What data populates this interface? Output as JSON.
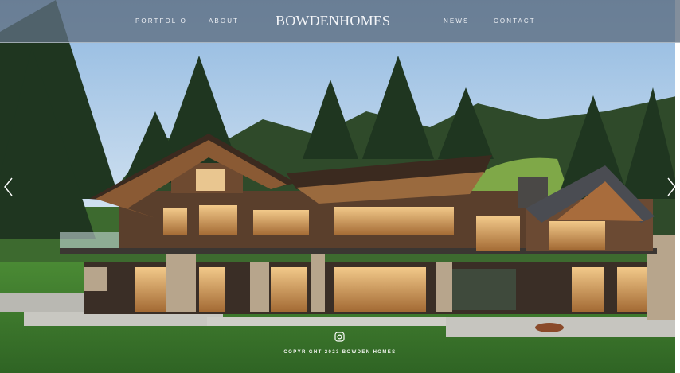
{
  "nav": {
    "left_links": [
      "PORTFOLIO",
      "ABOUT"
    ],
    "right_links": [
      "NEWS",
      "CONTACT"
    ],
    "logo_text": "BOWDENHOMES"
  },
  "hero": {
    "image_icon": "photo-of-modern-mountain-house",
    "prev_icon": "chevron-left-icon",
    "next_icon": "chevron-right-icon"
  },
  "footer": {
    "social_icon": "instagram-icon",
    "copyright": "COPYRIGHT 2023 BOWDEN HOMES"
  },
  "colors": {
    "nav_bar": "#5f6e80",
    "text": "#eef1f5",
    "lawn": "#3f7a2e"
  }
}
